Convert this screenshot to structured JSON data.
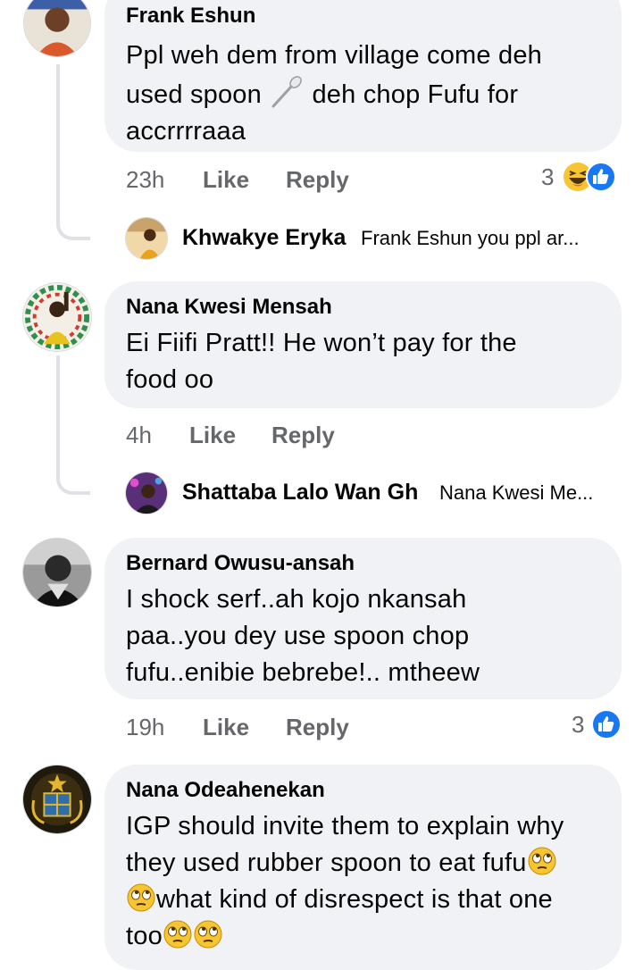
{
  "comments": [
    {
      "name": "Frank Eshun",
      "text_line1": "Ppl weh dem from village come deh",
      "text_line2a": "used spoon ",
      "text_line2b": " deh chop Fufu for",
      "text_line3": "accrrrraaa",
      "time": "23h",
      "like": "Like",
      "reply": "Reply",
      "reaction_count": "3",
      "reactions": [
        "haha-icon",
        "like-icon"
      ],
      "reply_preview": {
        "name": "Khwakye Eryka",
        "text": "Frank Eshun you ppl ar..."
      }
    },
    {
      "name": "Nana Kwesi Mensah",
      "text_line1": "Ei Fiifi Pratt!! He won’t pay for the",
      "text_line2": "food oo",
      "time": "4h",
      "like": "Like",
      "reply": "Reply",
      "reply_preview": {
        "name": "Shattaba Lalo Wan Gh",
        "text": "Nana Kwesi Me..."
      }
    },
    {
      "name": "Bernard Owusu-ansah",
      "text_line1": "I shock serf..ah kojo nkansah",
      "text_line2": "paa..you dey use spoon chop",
      "text_line3": "fufu..enibie bebrebe!.. mtheew",
      "time": "19h",
      "like": "Like",
      "reply": "Reply",
      "reaction_count": "3",
      "reactions": [
        "like-icon"
      ]
    },
    {
      "name": "Nana Odeahenekan",
      "text_line1": "IGP should invite them to explain why",
      "text_line2": "they used rubber spoon to eat fufu",
      "text_line3": "what kind of disrespect is that one",
      "text_line4": "too"
    }
  ],
  "colors": {
    "bubble": "#f0f2f5",
    "meta_text": "#65676b",
    "like_blue": "#1877f2",
    "haha_yellow": "#f7c532"
  }
}
